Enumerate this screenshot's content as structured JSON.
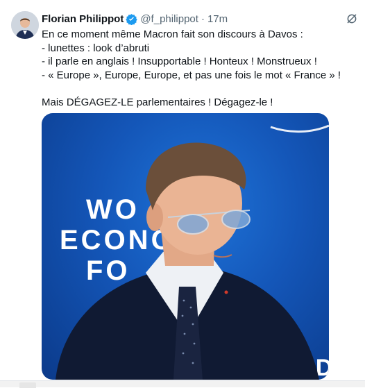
{
  "author": {
    "name": "Florian Philippot",
    "handle": "@f_philippot",
    "separator": "·",
    "time": "17m"
  },
  "tweet": {
    "lines": [
      "En ce moment même Macron fait son discours à Davos :",
      "- lunettes : look d’abruti",
      "- il parle en anglais ! Insupportable ! Honteux ! Monstrueux !",
      "- « Europe », Europe, Europe, et pas une fois le mot « France » !",
      "Mais DÉGAGEZ-LE parlementaires ! Dégagez-le !"
    ]
  },
  "media": {
    "backdrop_letters": [
      "WO",
      "ECONO",
      "FO",
      "LD"
    ]
  },
  "icons": {
    "verified": "verified-badge-icon",
    "more": "grok-slash-icon"
  },
  "colors": {
    "text": "#0f1419",
    "muted": "#536471",
    "verified": "#1d9bf0",
    "stage_blue": "#1456b8"
  }
}
